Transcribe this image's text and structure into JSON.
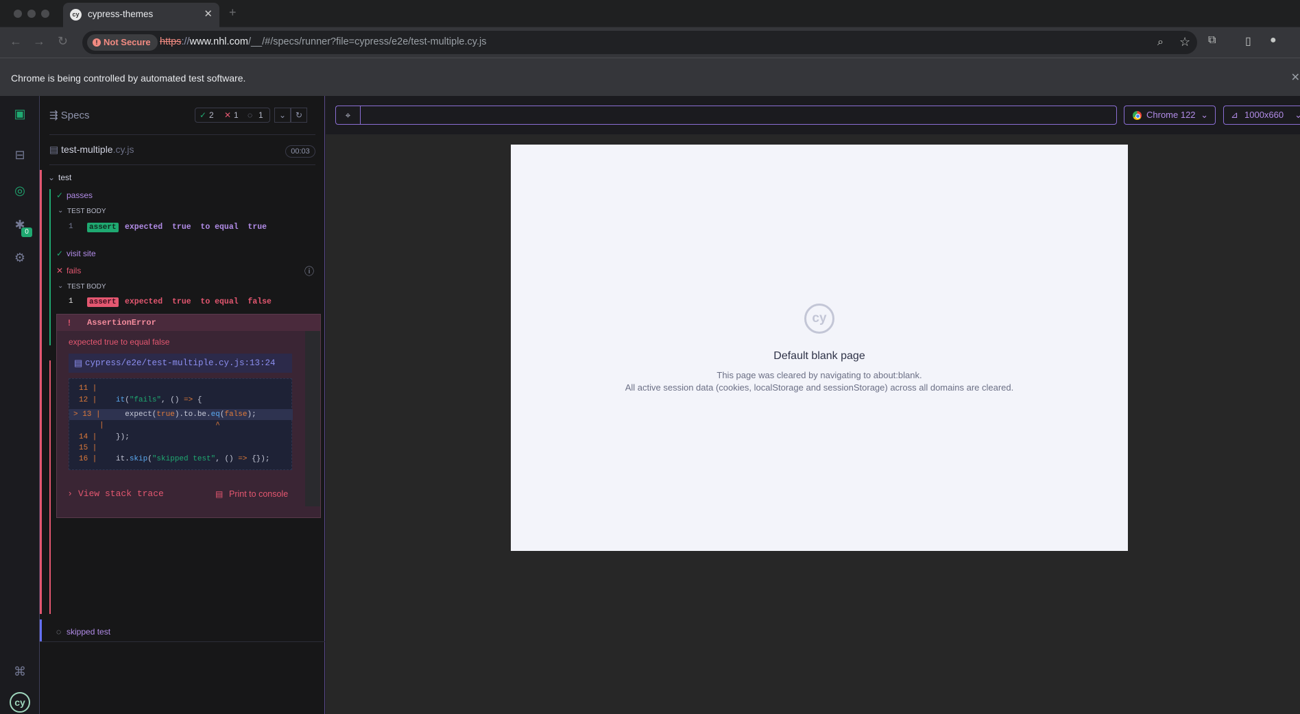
{
  "browser": {
    "tab_title": "cypress-themes",
    "tab_favicon": "cy",
    "security_label": "Not Secure",
    "url_protocol": "https",
    "url_host": "www.nhl.com",
    "url_rest": "/__/#/specs/runner?file=cypress/e2e/test-multiple.cy.js",
    "infobar_message": "Chrome is being controlled by automated test software."
  },
  "reporter": {
    "specs_label": "Specs",
    "stats": {
      "passed": "2",
      "failed": "1",
      "pending": "1"
    },
    "spec_name": "test-multiple",
    "spec_ext": ".cy.js",
    "duration": "00:03",
    "suite_title": "test",
    "tests": [
      {
        "title": "passes",
        "state": "passed"
      },
      {
        "title": "visit site",
        "state": "passed"
      },
      {
        "title": "fails",
        "state": "failed"
      },
      {
        "title": "skipped test",
        "state": "pending"
      }
    ],
    "test_body_label": "TEST BODY",
    "pass_command": {
      "num": "1",
      "name": "assert",
      "message": "expected  true  to equal  true"
    },
    "fail_command": {
      "num": "1",
      "name": "assert",
      "message": "expected  true  to equal  false"
    },
    "error": {
      "name": "AssertionError",
      "message": "expected true to equal false",
      "file_link": "cypress/e2e/test-multiple.cy.js:13:24",
      "view_stack_trace": "View stack trace",
      "print_to_console": "Print to console",
      "code_lines": [
        {
          "ln": "11 |",
          "src": ""
        },
        {
          "ln": "12 |",
          "src": "it(\"fails\", () => {"
        },
        {
          "ln": "> 13 |",
          "src": "  expect(true).to.be.eq(false);"
        },
        {
          "ln": "|",
          "src": "                      ^"
        },
        {
          "ln": "14 |",
          "src": "});"
        },
        {
          "ln": "15 |",
          "src": ""
        },
        {
          "ln": "16 |",
          "src": "it.skip(\"skipped test\", () => {});"
        }
      ]
    }
  },
  "aut": {
    "browser_label": "Chrome 122",
    "viewport_label": "1000x660",
    "url_value": "",
    "blank_title": "Default blank page",
    "blank_line1": "This page was cleared by navigating to about:blank.",
    "blank_line2": "All active session data (cookies, localStorage and sessionStorage) across all domains are cleared."
  },
  "nav": {
    "debug_badge": "0"
  },
  "colors": {
    "pass": "#1fa971",
    "fail": "#e45770",
    "accent": "#8c6fd6",
    "pending": "#6470f3"
  }
}
